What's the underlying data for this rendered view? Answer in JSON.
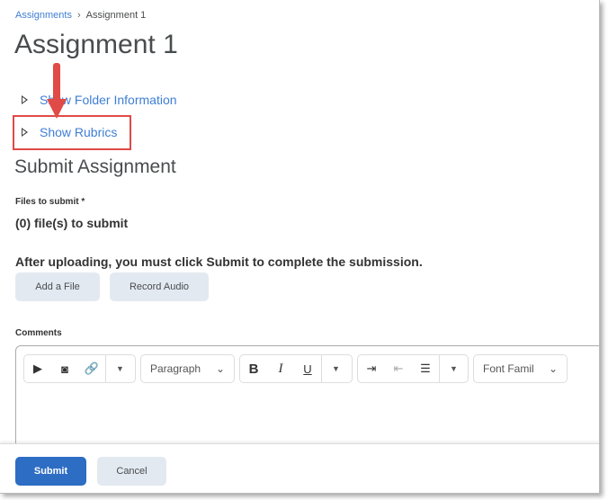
{
  "breadcrumb": {
    "parent": "Assignments",
    "current": "Assignment 1"
  },
  "title": "Assignment 1",
  "toggles": {
    "folder": "Show Folder Information",
    "rubrics": "Show Rubrics"
  },
  "section_title": "Submit Assignment",
  "files": {
    "label": "Files to submit *",
    "count": "(0) file(s) to submit"
  },
  "instruction": "After uploading, you must click Submit to complete the submission.",
  "buttons": {
    "add_file": "Add a File",
    "record_audio": "Record Audio",
    "submit": "Submit",
    "cancel": "Cancel"
  },
  "comments": {
    "label": "Comments",
    "format": "Paragraph",
    "font": "Font Famil"
  },
  "colors": {
    "accent": "#2d6dc3",
    "link": "#3f7fd4",
    "annotation": "#e04a47"
  }
}
